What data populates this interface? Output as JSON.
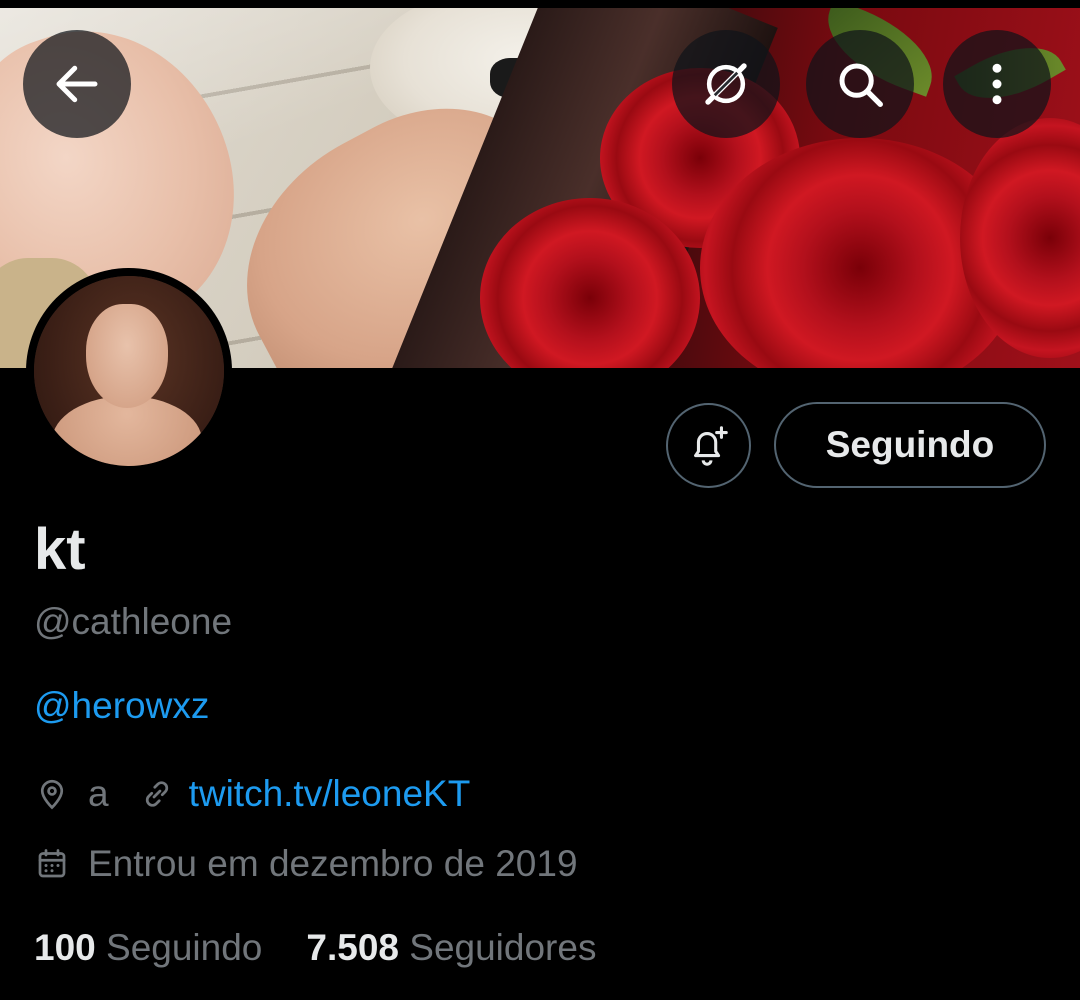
{
  "header": {
    "back_icon": "arrow-left-icon",
    "grok_icon": "grok-icon",
    "search_icon": "search-icon",
    "more_icon": "more-vertical-icon"
  },
  "actions": {
    "notifications_icon": "bell-plus-icon",
    "following_label": "Seguindo"
  },
  "profile": {
    "display_name": "kt",
    "handle": "@cathleone",
    "bio": "@herowxz",
    "location": "a",
    "website": "twitch.tv/leoneKT",
    "joined": "Entrou em dezembro de 2019"
  },
  "stats": {
    "following_count": "100",
    "following_label": "Seguindo",
    "followers_count": "7.508",
    "followers_label": "Seguidores"
  },
  "colors": {
    "background": "#000000",
    "primary_text": "#e7e9ea",
    "secondary_text": "#71767b",
    "link": "#1d9bf0",
    "border": "#536471"
  }
}
